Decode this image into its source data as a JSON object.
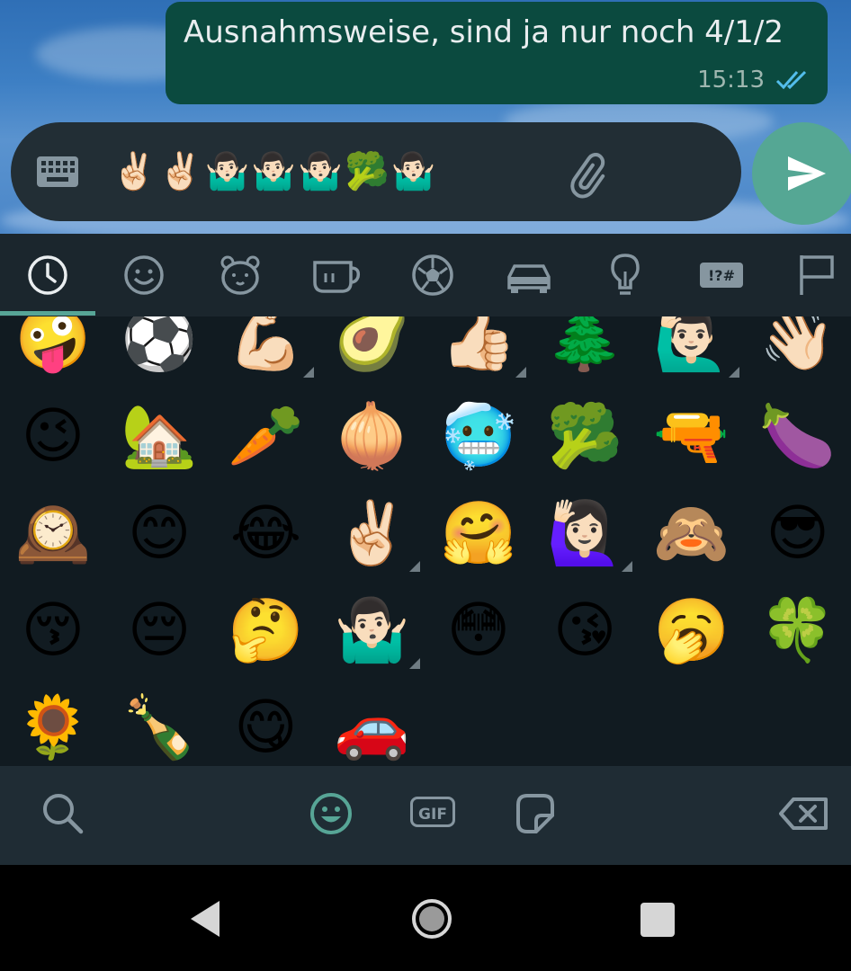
{
  "message": {
    "text": "Ausnahmsweise, sind ja nur noch 4/1/2",
    "time": "15:13",
    "status": "read"
  },
  "compose": {
    "text": "✌🏻✌🏻🤷🏻‍♂️🤷🏻‍♂️🤷🏻‍♂️🥦🤷🏻‍♂️"
  },
  "keyboard": {
    "tabs": [
      "recent-icon",
      "smileys-icon",
      "animals-icon",
      "food-icon",
      "activities-icon",
      "travel-icon",
      "objects-icon",
      "symbols-icon",
      "flags-icon"
    ],
    "active_tab": "recent",
    "symbols_tab_label": "!?#",
    "gif_label": "GIF",
    "recent_emojis": [
      [
        "🤪",
        "⚽",
        "💪🏻",
        "🥑",
        "👍🏻",
        "🌲",
        "🙋🏻‍♂️",
        "👋🏻"
      ],
      [
        "😉",
        "🏡",
        "🥕",
        "🧅",
        "🥶",
        "🥦",
        "🔫",
        "🍆"
      ],
      [
        "🕰️",
        "😊",
        "😂",
        "✌🏻",
        "🤗",
        "🙋🏻‍♀️",
        "🙈",
        "😎"
      ],
      [
        "😚",
        "😔",
        "🤔",
        "🤷🏻‍♂️",
        "😳",
        "😘",
        "🥱",
        "🍀"
      ],
      [
        "🌻",
        "🍾",
        "😋",
        "🚗"
      ]
    ]
  },
  "colors": {
    "bubble": "#0b4a3f",
    "accent": "#55a794",
    "keyboard_bg": "#1b262d"
  }
}
